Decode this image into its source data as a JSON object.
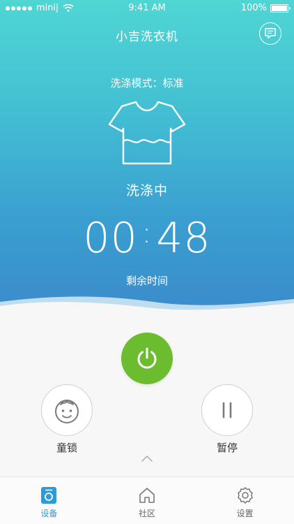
{
  "status_bar": {
    "carrier": "minij",
    "time": "9:41 AM",
    "battery": "100%"
  },
  "header": {
    "title": "小吉洗衣机"
  },
  "washer": {
    "mode_label": "洗涤模式：标准",
    "state": "洗涤中",
    "timer_minutes": "00",
    "timer_seconds": "48",
    "remaining_label": "剩余时间"
  },
  "controls": {
    "child_lock_label": "童锁",
    "pause_label": "暂停"
  },
  "tabs": [
    {
      "label": "设备",
      "icon": "device-icon",
      "active": true
    },
    {
      "label": "社区",
      "icon": "home-icon",
      "active": false
    },
    {
      "label": "设置",
      "icon": "gear-icon",
      "active": false
    }
  ],
  "colors": {
    "accent": "#2e9bd6",
    "power": "#6bbd2f",
    "gradient_top": "#4fd6d3",
    "gradient_bottom": "#3b8bcb"
  }
}
